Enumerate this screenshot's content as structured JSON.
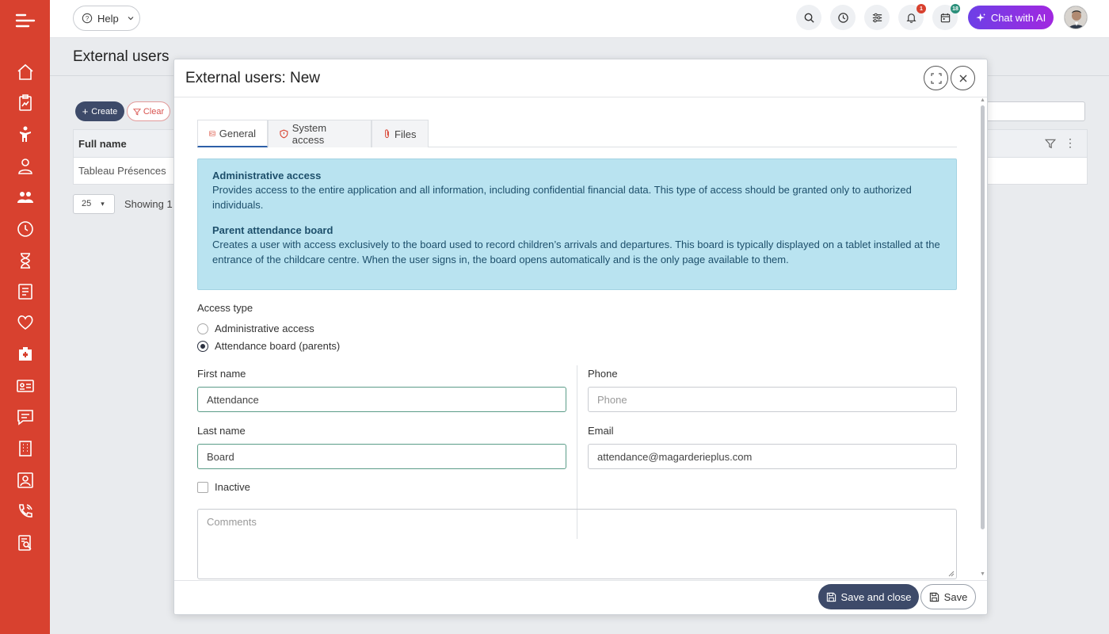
{
  "topbar": {
    "help_label": "Help",
    "notif_badge": "1",
    "calendar_badge": "18",
    "chat_label": "Chat with AI"
  },
  "page": {
    "title": "External users",
    "create_label": "Create",
    "clear_label": "Clear",
    "table_header": "Full name",
    "table_row": "Tableau Présences",
    "page_size": "25",
    "showing": "Showing 1"
  },
  "modal": {
    "title": "External users: New",
    "tabs": [
      {
        "label": "General"
      },
      {
        "label": "System access"
      },
      {
        "label": "Files"
      }
    ],
    "info": {
      "admin_heading": "Administrative access",
      "admin_text": "Provides access to the entire application and all information, including confidential financial data. This type of access should be granted only to authorized individuals.",
      "parent_heading": "Parent attendance board",
      "parent_text": "Creates a user with access exclusively to the board used to record children’s arrivals and departures. This board is typically displayed on a tablet installed at the entrance of the childcare centre. When the user signs in, the board opens automatically and is the only page available to them."
    },
    "access_type_label": "Access type",
    "access_options": [
      "Administrative access",
      "Attendance board (parents)"
    ],
    "first_name_label": "First name",
    "first_name_value": "Attendance",
    "last_name_label": "Last name",
    "last_name_value": "Board",
    "phone_label": "Phone",
    "phone_placeholder": "Phone",
    "email_label": "Email",
    "email_value": "attendance@magarderieplus.com",
    "inactive_label": "Inactive",
    "comments_placeholder": "Comments",
    "save_close_label": "Save and close",
    "save_label": "Save"
  },
  "colors": {
    "sidebar": "#d8412f",
    "primary": "#3d4a69",
    "info_bg": "#b9e3f0",
    "chat_gradient": "#8a2be2"
  }
}
